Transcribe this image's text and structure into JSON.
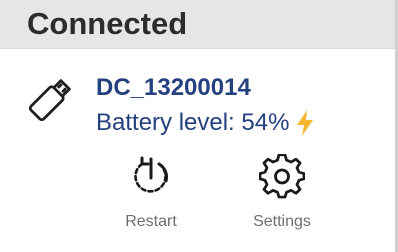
{
  "header": {
    "title": "Connected"
  },
  "device": {
    "icon": "usb-stick-icon",
    "name": "DC_13200014",
    "battery_label": "Battery level: 54%",
    "battery_level_percent": 54,
    "charging_icon": "lightning-bolt-icon"
  },
  "actions": [
    {
      "label": "Restart",
      "icon": "restart-power-icon"
    },
    {
      "label": "Settings",
      "icon": "gear-icon"
    }
  ],
  "colors": {
    "header_background": "#e6e6e6",
    "header_text": "#2c2c2c",
    "device_text": "#24407f",
    "bolt": "#f7b733",
    "action_label": "#6e6e6e"
  }
}
